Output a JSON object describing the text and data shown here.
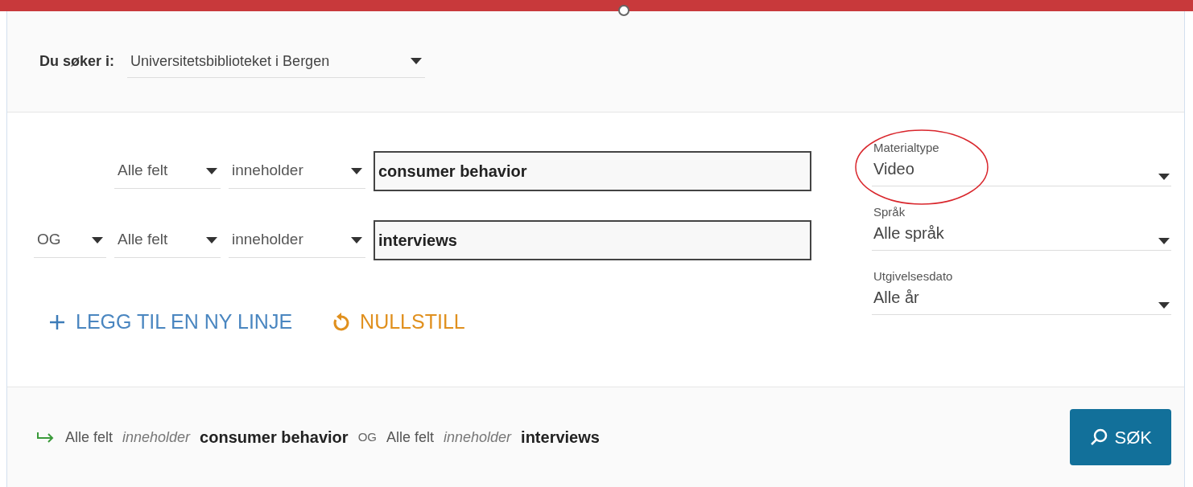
{
  "scope": {
    "label": "Du søker i:",
    "value": "Universitetsbiblioteket i Bergen"
  },
  "query_rows": [
    {
      "boolean": null,
      "field": "Alle felt",
      "operator": "inneholder",
      "value": "consumer behavior"
    },
    {
      "boolean": "OG",
      "field": "Alle felt",
      "operator": "inneholder",
      "value": "interviews"
    }
  ],
  "actions": [
    {
      "kind": "add",
      "label": "LEGG TIL EN NY LINJE"
    },
    {
      "kind": "reset",
      "label": "NULLSTILL"
    }
  ],
  "filters": [
    {
      "label": "Materialtype",
      "value": "Video",
      "circled": true
    },
    {
      "label": "Språk",
      "value": "Alle språk",
      "circled": false
    },
    {
      "label": "Utgivelsesdato",
      "value": "Alle år",
      "circled": false
    }
  ],
  "summary": [
    {
      "kind": "field",
      "text": "Alle felt"
    },
    {
      "kind": "operator",
      "text": "inneholder"
    },
    {
      "kind": "term",
      "text": "consumer behavior"
    },
    {
      "kind": "boolean",
      "text": "OG"
    },
    {
      "kind": "field",
      "text": "Alle felt"
    },
    {
      "kind": "operator",
      "text": "inneholder"
    },
    {
      "kind": "term",
      "text": "interviews"
    }
  ],
  "search_button": "SØK"
}
